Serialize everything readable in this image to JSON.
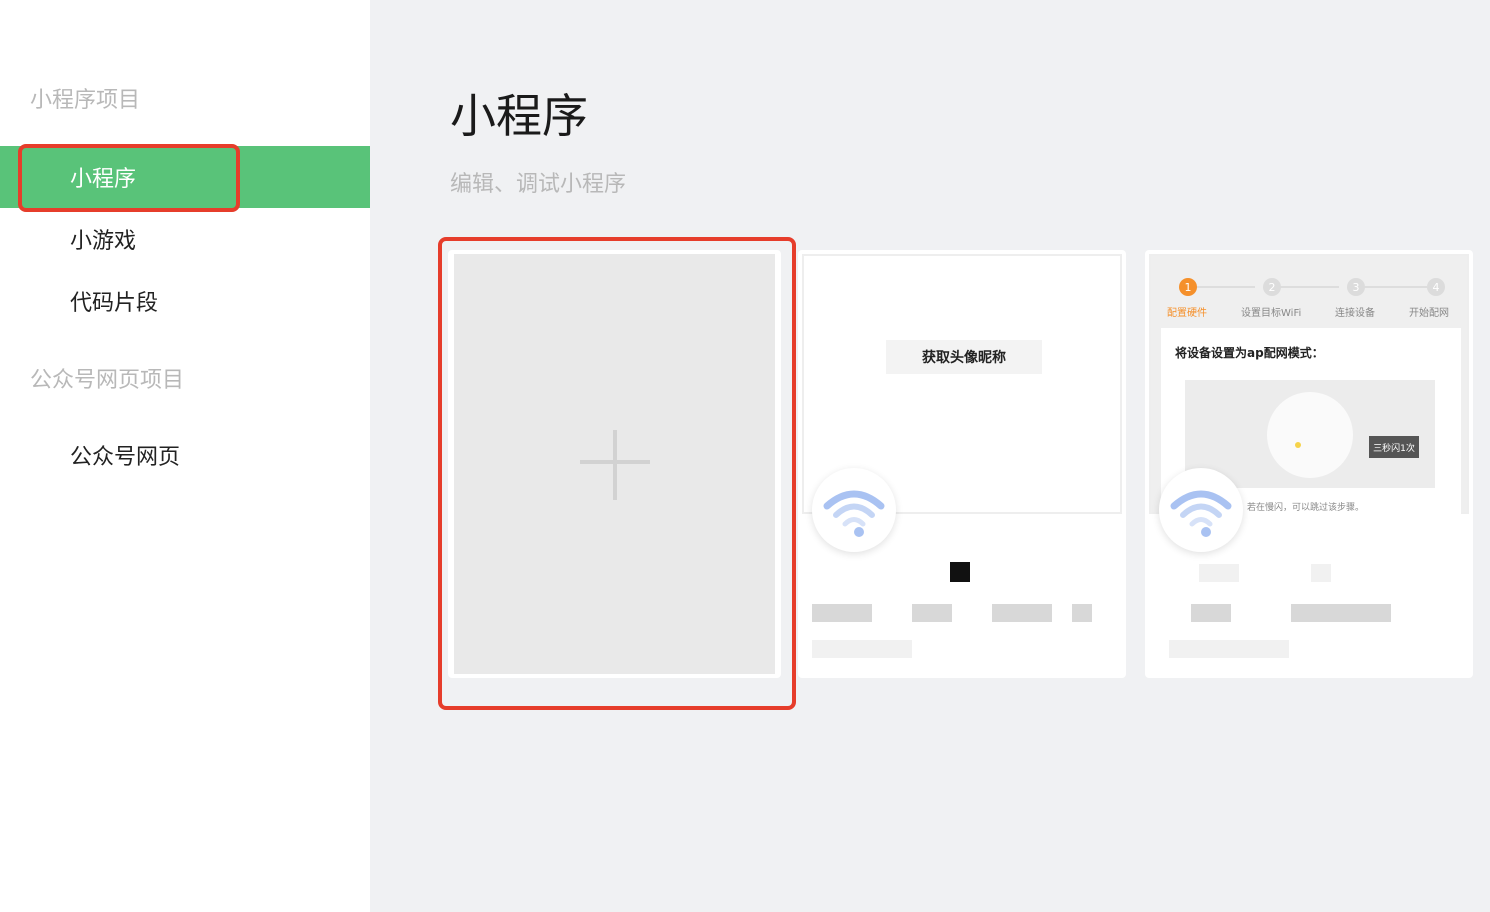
{
  "sidebar": {
    "section_miniprogram": "小程序项目",
    "items": [
      {
        "label": "小程序"
      },
      {
        "label": "小游戏"
      },
      {
        "label": "代码片段"
      }
    ],
    "section_official": "公众号网页项目",
    "official_items": [
      {
        "label": "公众号网页"
      }
    ]
  },
  "main": {
    "title": "小程序",
    "subtitle": "编辑、调试小程序",
    "create_card_icon": "plus-icon",
    "templates": [
      {
        "preview_button": "获取头像昵称"
      },
      {
        "steps": [
          "配置硬件",
          "设置目标WiFi",
          "连接设备",
          "开始配网"
        ],
        "step_numbers": [
          "1",
          "2",
          "3",
          "4"
        ],
        "heading": "将设备设置为ap配网模式：",
        "tag": "三秒闪1次",
        "note": "若在慢闪，可以跳过该步骤。"
      }
    ]
  },
  "colors": {
    "accent": "#59c379",
    "highlight": "#e63d2b",
    "step_active": "#f5902b"
  }
}
